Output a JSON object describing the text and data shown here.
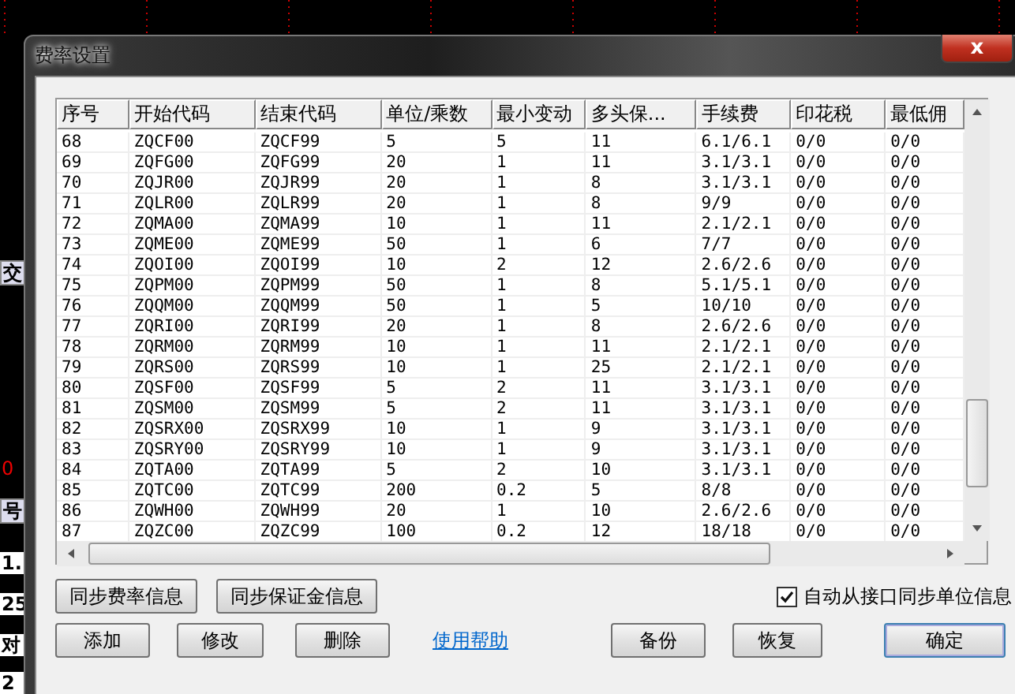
{
  "background_fragments": [
    {
      "text": "交",
      "kind": "box"
    },
    {
      "text": "0",
      "kind": "red"
    },
    {
      "text": "号",
      "kind": "box"
    },
    {
      "text": "1.",
      "kind": "plain"
    },
    {
      "text": "25",
      "kind": "plain"
    },
    {
      "text": "对",
      "kind": "plain"
    },
    {
      "text": "2",
      "kind": "plain"
    }
  ],
  "window": {
    "title": "费率设置",
    "close": "x"
  },
  "table": {
    "columns": [
      "序号",
      "开始代码",
      "结束代码",
      "单位/乘数",
      "最小变动",
      "多头保...",
      "手续费",
      "印花税",
      "最低佣"
    ],
    "rows": [
      [
        "68",
        "ZQCF00",
        "ZQCF99",
        "5",
        "5",
        "11",
        "6.1/6.1",
        "0/0",
        "0/0"
      ],
      [
        "69",
        "ZQFG00",
        "ZQFG99",
        "20",
        "1",
        "11",
        "3.1/3.1",
        "0/0",
        "0/0"
      ],
      [
        "70",
        "ZQJR00",
        "ZQJR99",
        "20",
        "1",
        "8",
        "3.1/3.1",
        "0/0",
        "0/0"
      ],
      [
        "71",
        "ZQLR00",
        "ZQLR99",
        "20",
        "1",
        "8",
        "9/9",
        "0/0",
        "0/0"
      ],
      [
        "72",
        "ZQMA00",
        "ZQMA99",
        "10",
        "1",
        "11",
        "2.1/2.1",
        "0/0",
        "0/0"
      ],
      [
        "73",
        "ZQME00",
        "ZQME99",
        "50",
        "1",
        "6",
        "7/7",
        "0/0",
        "0/0"
      ],
      [
        "74",
        "ZQOI00",
        "ZQOI99",
        "10",
        "2",
        "12",
        "2.6/2.6",
        "0/0",
        "0/0"
      ],
      [
        "75",
        "ZQPM00",
        "ZQPM99",
        "50",
        "1",
        "8",
        "5.1/5.1",
        "0/0",
        "0/0"
      ],
      [
        "76",
        "ZQQM00",
        "ZQQM99",
        "50",
        "1",
        "5",
        "10/10",
        "0/0",
        "0/0"
      ],
      [
        "77",
        "ZQRI00",
        "ZQRI99",
        "20",
        "1",
        "8",
        "2.6/2.6",
        "0/0",
        "0/0"
      ],
      [
        "78",
        "ZQRM00",
        "ZQRM99",
        "10",
        "1",
        "11",
        "2.1/2.1",
        "0/0",
        "0/0"
      ],
      [
        "79",
        "ZQRS00",
        "ZQRS99",
        "10",
        "1",
        "25",
        "2.1/2.1",
        "0/0",
        "0/0"
      ],
      [
        "80",
        "ZQSF00",
        "ZQSF99",
        "5",
        "2",
        "11",
        "3.1/3.1",
        "0/0",
        "0/0"
      ],
      [
        "81",
        "ZQSM00",
        "ZQSM99",
        "5",
        "2",
        "11",
        "3.1/3.1",
        "0/0",
        "0/0"
      ],
      [
        "82",
        "ZQSRX00",
        "ZQSRX99",
        "10",
        "1",
        "9",
        "3.1/3.1",
        "0/0",
        "0/0"
      ],
      [
        "83",
        "ZQSRY00",
        "ZQSRY99",
        "10",
        "1",
        "9",
        "3.1/3.1",
        "0/0",
        "0/0"
      ],
      [
        "84",
        "ZQTA00",
        "ZQTA99",
        "5",
        "2",
        "10",
        "3.1/3.1",
        "0/0",
        "0/0"
      ],
      [
        "85",
        "ZQTC00",
        "ZQTC99",
        "200",
        "0.2",
        "5",
        "8/8",
        "0/0",
        "0/0"
      ],
      [
        "86",
        "ZQWH00",
        "ZQWH99",
        "20",
        "1",
        "10",
        "2.6/2.6",
        "0/0",
        "0/0"
      ],
      [
        "87",
        "ZQZC00",
        "ZQZC99",
        "100",
        "0.2",
        "12",
        "18/18",
        "0/0",
        "0/0"
      ]
    ]
  },
  "sync_buttons": [
    "同步费率信息",
    "同步保证金信息"
  ],
  "auto_sync": {
    "label": "自动从接口同步单位信息",
    "checked": true
  },
  "actions": [
    {
      "label": "添加",
      "kind": "button"
    },
    {
      "label": "修改",
      "kind": "button"
    },
    {
      "label": "删除",
      "kind": "button"
    },
    {
      "label": "使用帮助",
      "kind": "link"
    },
    {
      "label": "备份",
      "kind": "button"
    },
    {
      "label": "恢复",
      "kind": "button"
    },
    {
      "label": "确定",
      "kind": "default"
    }
  ]
}
